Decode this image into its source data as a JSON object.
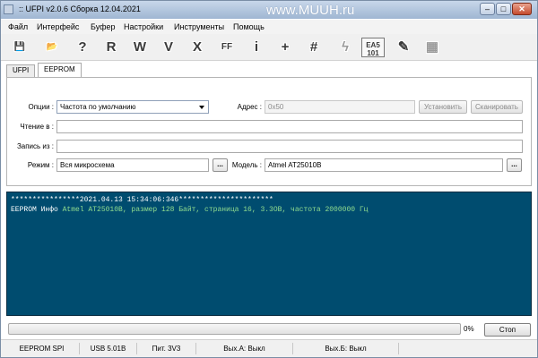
{
  "window": {
    "title": ":: UFPI v2.0.6 Сборка 12.04.2021",
    "watermark": "www.MUUH.ru",
    "controls": {
      "minimize": "–",
      "maximize": "□",
      "close": "✕"
    }
  },
  "menu": [
    "Файл",
    "Интерфейс",
    "Буфер",
    "Настройки",
    "Инструменты",
    "Помощь"
  ],
  "toolbar": {
    "buttons": [
      {
        "icon": "save-icon",
        "glyph": "💾"
      },
      {
        "icon": "open-folder-icon",
        "glyph": "📂"
      },
      {
        "icon": "identify-chip-icon",
        "glyph": "?"
      },
      {
        "icon": "read-icon",
        "glyph": "R"
      },
      {
        "icon": "write-icon",
        "glyph": "W"
      },
      {
        "icon": "verify-icon",
        "glyph": "V"
      },
      {
        "icon": "erase-icon",
        "glyph": "X"
      },
      {
        "icon": "blank-check-icon",
        "glyph": "FF"
      },
      {
        "icon": "info-icon",
        "glyph": "i"
      },
      {
        "icon": "add-icon",
        "glyph": "+"
      },
      {
        "icon": "checksum-icon",
        "glyph": "#"
      },
      {
        "icon": "lightning-icon",
        "glyph": "ϟ"
      },
      {
        "icon": "eas-icon",
        "glyph": "EA5\n101"
      },
      {
        "icon": "edit-icon",
        "glyph": "✎"
      },
      {
        "icon": "hex-grid-icon",
        "glyph": "▦"
      }
    ]
  },
  "tabs": [
    {
      "label": "UFPI",
      "active": false
    },
    {
      "label": "EEPROM",
      "active": true
    }
  ],
  "form": {
    "options_label": "Опции :",
    "options_value": "Частота по умолчанию",
    "address_label": "Адрес :",
    "address_value": "0x50",
    "set_button": "Установить",
    "scan_button": "Сканировать",
    "read_label": "Чтение в :",
    "read_value": "",
    "write_label": "Запись из :",
    "write_value": "",
    "mode_label": "Режим :",
    "mode_value": "Вся микросхема",
    "browse_label": "...",
    "model_label": "Модель :",
    "model_value": "Atmel AT25010B",
    "model_browse_label": "..."
  },
  "console": {
    "header": "****************2021.04.13 15:34:06:346**********************",
    "entry_prefix": "EEPROM Инфо ",
    "entry_text": "Atmel AT25010B, размер 128 Байт, страница 16, 3.3ОВ, частота 2000000 Гц",
    "colors": {
      "background": "#004c6f",
      "text": "#ffffff",
      "highlight": "#8fdc8f"
    }
  },
  "progress": {
    "value": 0,
    "label": "0%"
  },
  "stop_button": "Стоп",
  "statusbar": [
    "EEPROM SPI",
    "USB 5.01B",
    "Пит. 3V3",
    "Вых.А: Выкл",
    "Вых.Б: Выкл"
  ]
}
